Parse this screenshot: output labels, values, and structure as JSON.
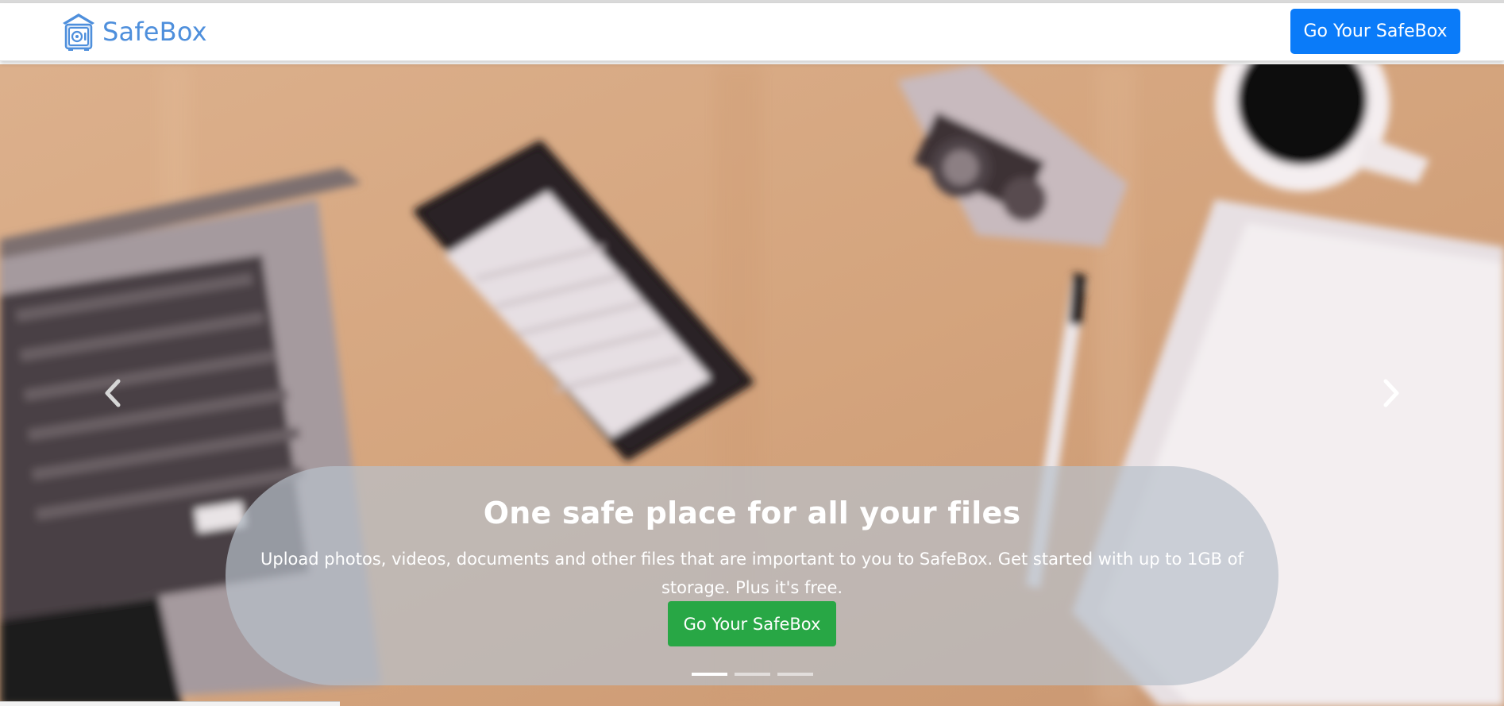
{
  "navbar": {
    "brand_name": "SafeBox",
    "brand_icon": "safe-house-icon",
    "cta_label": "Go Your SafeBox",
    "colors": {
      "brand": "#4e8fdc",
      "cta": "#0a7bf9"
    }
  },
  "hero": {
    "background_photo": "blurred-desk-laptop-phone-camera-coffee-notebook",
    "prev_icon": "chevron-left-icon",
    "next_icon": "chevron-right-icon",
    "caption": {
      "title": "One safe place for all your files",
      "text": "Upload photos, videos, documents and other files that are important to you to SafeBox. Get started with up to 1GB of storage. Plus it's free.",
      "button_label": "Go Your SafeBox",
      "button_color": "#28a745"
    },
    "indicators": {
      "count": 3,
      "active_index": 0
    }
  }
}
